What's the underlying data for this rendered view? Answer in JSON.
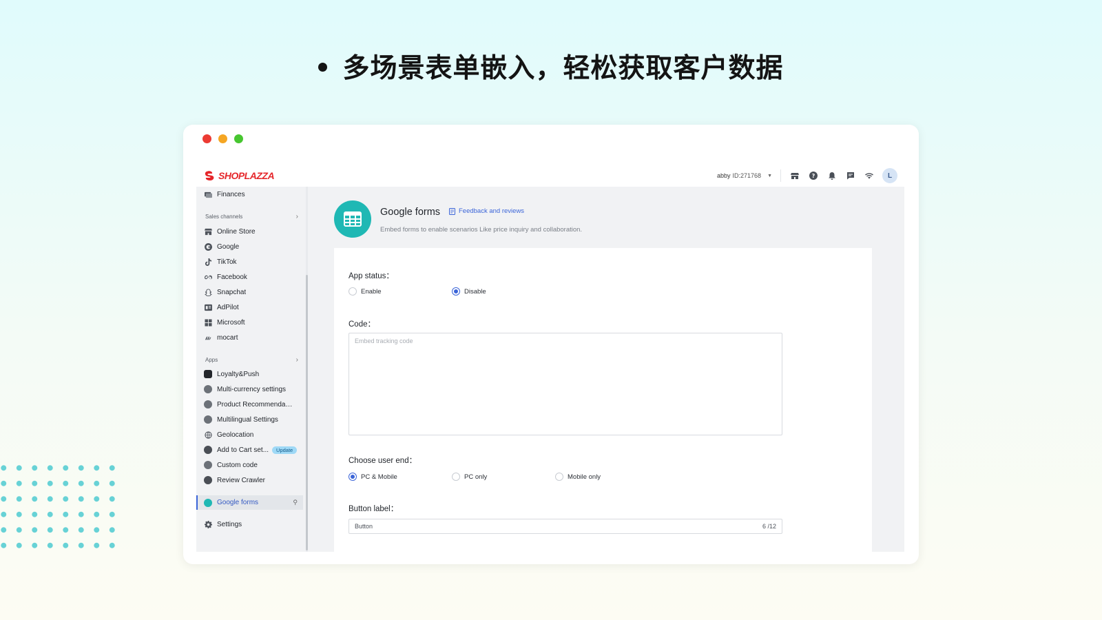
{
  "headline": "多场景表单嵌入，轻松获取客户数据",
  "brand": {
    "logo_text": "SHOPLAZZA",
    "color": "#e5262a"
  },
  "topbar": {
    "store_name": "abby",
    "store_id": "ID:271768",
    "icons": [
      "store-icon",
      "help-icon",
      "bell-icon",
      "message-icon",
      "wifi-icon"
    ],
    "avatar_letter": "L"
  },
  "sidebar": {
    "finances": "Finances",
    "sales_channels_title": "Sales channels",
    "sales_channels": [
      "Online Store",
      "Google",
      "TikTok",
      "Facebook",
      "Snapchat",
      "AdPilot",
      "Microsoft",
      "mocart"
    ],
    "apps_title": "Apps",
    "apps": [
      "Loyalty&Push",
      "Multi-currency settings",
      "Product Recommendati...",
      "Multilingual Settings",
      "Geolocation",
      "Add to Cart set...",
      "Custom code",
      "Review Crawler"
    ],
    "update_badge": "Update",
    "active_item": "Google forms",
    "settings": "Settings"
  },
  "main": {
    "title": "Google forms",
    "feedback_link": "Feedback and reviews",
    "description": "Embed forms to enable scenarios Like price inquiry and collaboration.",
    "app_status_label": "App status：",
    "app_status_options": [
      "Enable",
      "Disable"
    ],
    "app_status_selected": "Disable",
    "code_label": "Code：",
    "code_placeholder": "Embed tracking code",
    "user_end_label": "Choose user end：",
    "user_end_options": [
      "PC & Mobile",
      "PC only",
      "Mobile only"
    ],
    "user_end_selected": "PC & Mobile",
    "button_label_label": "Button label：",
    "button_label_value": "Button",
    "button_label_count": "6 /12"
  },
  "colors": {
    "accent": "#3a64d8",
    "app_icon": "#1fb8b4"
  }
}
